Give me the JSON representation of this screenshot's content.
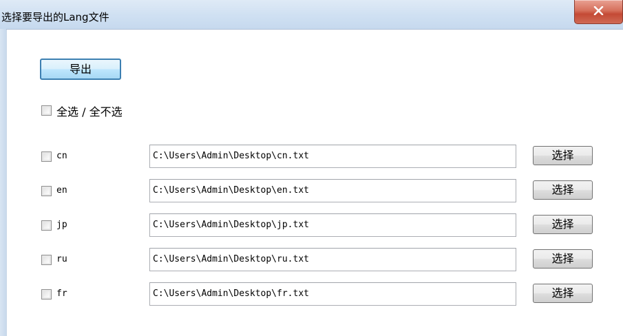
{
  "window": {
    "title": "选择要导出的Lang文件",
    "close_symbol": "X"
  },
  "toolbar": {
    "export_label": "导出"
  },
  "select_all": {
    "label": "全选 / 全不选",
    "checked": false
  },
  "files": [
    {
      "code": "cn",
      "path": "C:\\Users\\Admin\\Desktop\\cn.txt",
      "button_label": "选择",
      "checked": false
    },
    {
      "code": "en",
      "path": "C:\\Users\\Admin\\Desktop\\en.txt",
      "button_label": "选择",
      "checked": false
    },
    {
      "code": "jp",
      "path": "C:\\Users\\Admin\\Desktop\\jp.txt",
      "button_label": "选择",
      "checked": false
    },
    {
      "code": "ru",
      "path": "C:\\Users\\Admin\\Desktop\\ru.txt",
      "button_label": "选择",
      "checked": false
    },
    {
      "code": "fr",
      "path": "C:\\Users\\Admin\\Desktop\\fr.txt",
      "button_label": "选择",
      "checked": false
    }
  ],
  "colors": {
    "titlebar": "#cfe0f2",
    "close_button": "#c44a35",
    "default_button_border": "#3c7fb1"
  },
  "icons": {
    "close": "close-icon"
  }
}
